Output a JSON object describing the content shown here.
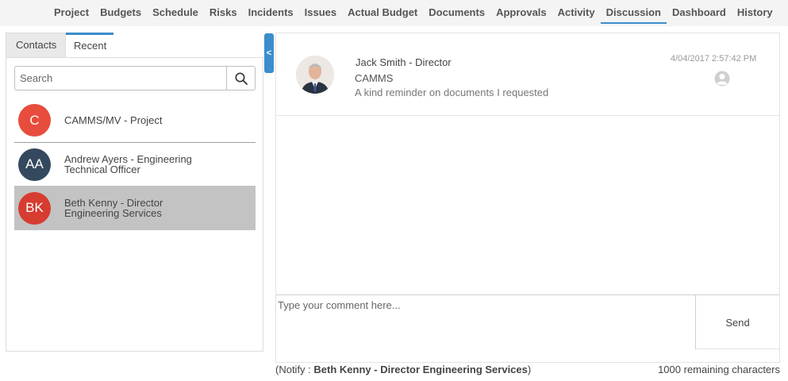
{
  "nav": {
    "items": [
      "Project",
      "Budgets",
      "Schedule",
      "Risks",
      "Incidents",
      "Issues",
      "Actual Budget",
      "Documents",
      "Approvals",
      "Activity",
      "Discussion",
      "Dashboard",
      "History"
    ],
    "active": "Discussion",
    "accent_color": "#3b8ecb"
  },
  "tabs": {
    "contacts": "Contacts",
    "recent": "Recent"
  },
  "search": {
    "placeholder": "Search",
    "icon": "search-icon"
  },
  "contacts": [
    {
      "initials": "C",
      "name": "CAMMS/MV - Project",
      "color": "#e74c3c",
      "selected": false
    },
    {
      "initials": "AA",
      "name": "Andrew Ayers - Engineering Technical Officer",
      "color": "#34495e",
      "selected": false
    },
    {
      "initials": "BK",
      "name": "Beth Kenny - Director Engineering Services",
      "color": "#d63c30",
      "selected": true
    }
  ],
  "collapse_label": "<",
  "message": {
    "author": "Jack Smith - Director",
    "subject": "CAMMS",
    "body": "A kind reminder on documents I requested",
    "timestamp": "4/04/2017 2:57:42 PM"
  },
  "comment": {
    "placeholder": "Type your comment here...",
    "send_label": "Send"
  },
  "notify": {
    "prefix": "(Notify : ",
    "name": "Beth Kenny - Director Engineering Services",
    "suffix": ")"
  },
  "remaining": "1000 remaining characters"
}
